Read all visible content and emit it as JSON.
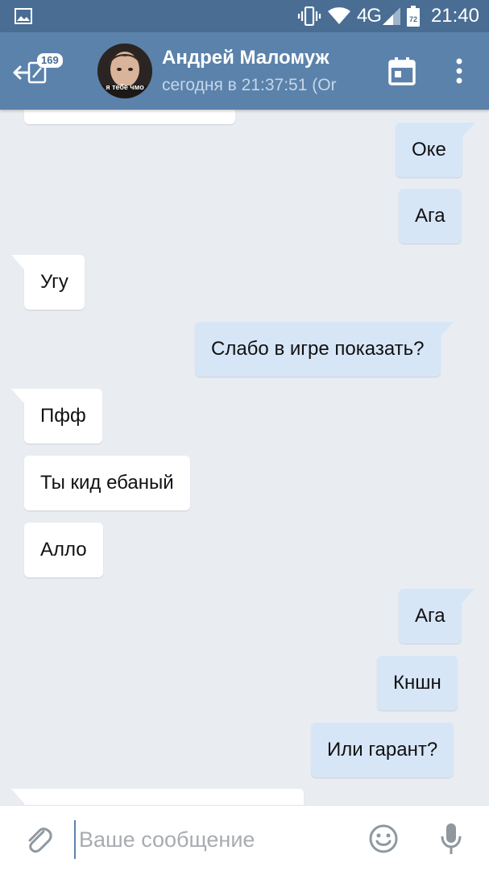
{
  "status_bar": {
    "network": "4G",
    "battery": "72",
    "time": "21:40",
    "icons": [
      "image-notification-icon",
      "vibrate-icon",
      "wifi-icon",
      "signal-icon",
      "battery-icon"
    ]
  },
  "header": {
    "back_badge": "169",
    "avatar_caption": "я тебе чмо",
    "contact_name": "Андрей Маломуж",
    "last_seen": "сегодня в 21:37:51 (Or",
    "icons": [
      "back-arrow-icon",
      "calendar-icon",
      "more-vert-icon"
    ]
  },
  "messages": [
    {
      "dir": "in",
      "text": ""
    },
    {
      "dir": "out",
      "text": "Оке"
    },
    {
      "dir": "out",
      "text": "Ага"
    },
    {
      "dir": "in",
      "text": "Угу"
    },
    {
      "dir": "out",
      "text": "Слабо в игре показать?"
    },
    {
      "dir": "in",
      "text": "Пфф"
    },
    {
      "dir": "in",
      "text": "Ты кид ебаный"
    },
    {
      "dir": "in",
      "text": "Алло"
    },
    {
      "dir": "out",
      "text": "Ага"
    },
    {
      "dir": "out",
      "text": "Кншн"
    },
    {
      "dir": "out",
      "text": "Или гарант?"
    },
    {
      "dir": "in",
      "text": ""
    }
  ],
  "input_bar": {
    "placeholder": "Ваше сообщение",
    "icons": [
      "paperclip-icon",
      "emoji-icon",
      "microphone-icon"
    ]
  },
  "colors": {
    "status_bar": "#4a6d93",
    "header": "#5b82ab",
    "background": "#e9edf2",
    "outgoing_bubble": "#d7e6f7",
    "incoming_bubble": "#ffffff"
  }
}
